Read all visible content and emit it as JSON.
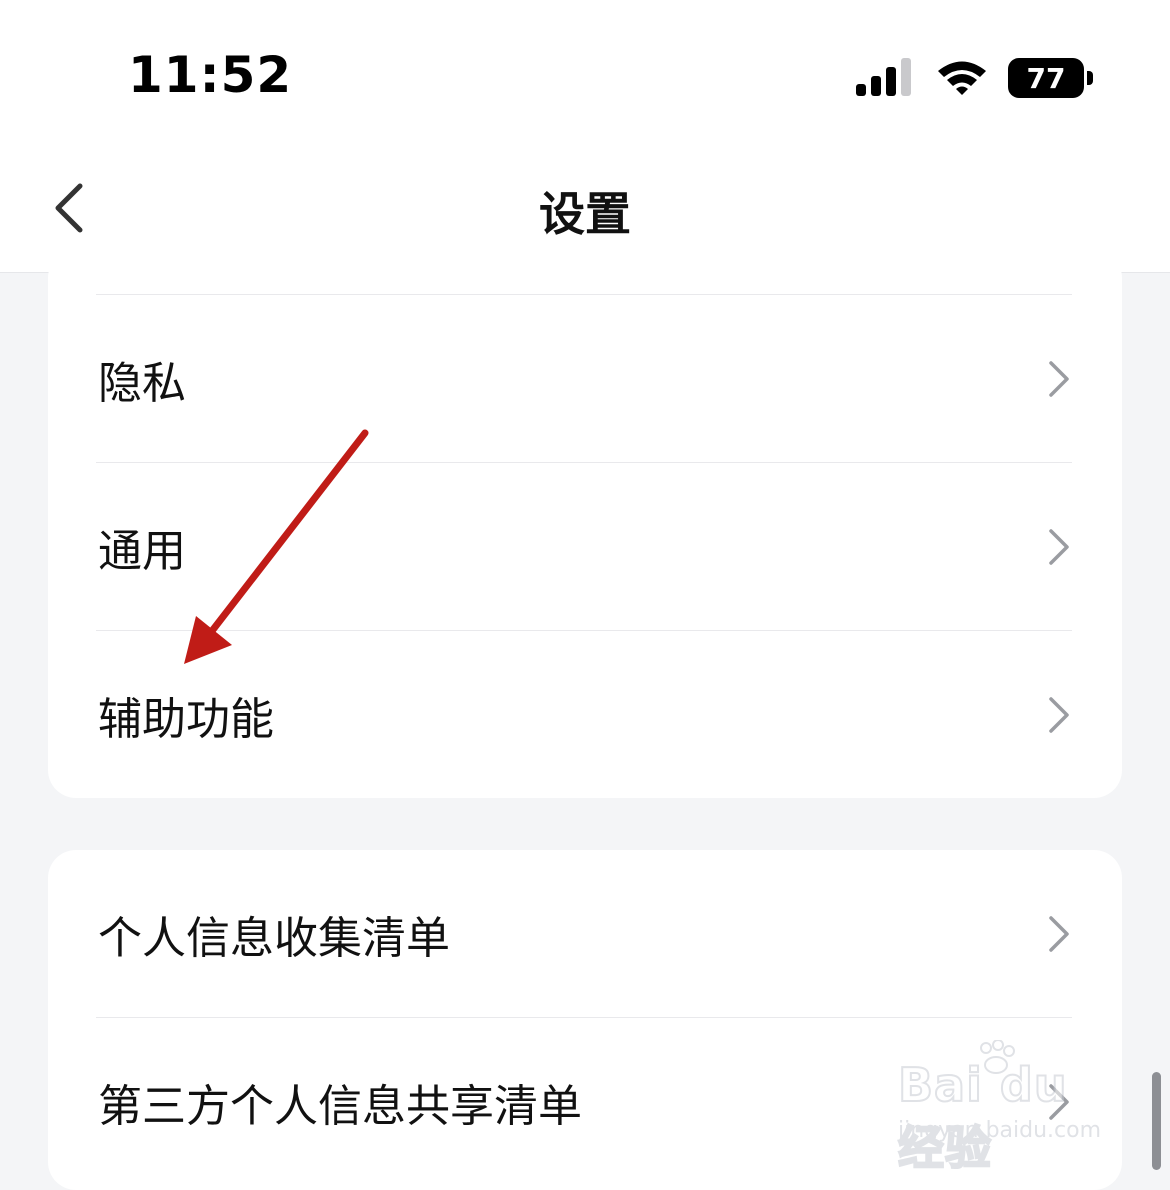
{
  "status_bar": {
    "time": "11:52",
    "battery_level": "77"
  },
  "nav": {
    "title": "设置",
    "back_icon": "chevron-left-icon"
  },
  "group1": {
    "items": [
      {
        "label": "隐私"
      },
      {
        "label": "通用"
      },
      {
        "label": "辅助功能"
      }
    ]
  },
  "group2": {
    "items": [
      {
        "label": "个人信息收集清单"
      },
      {
        "label": "第三方个人信息共享清单"
      }
    ]
  },
  "annotation": {
    "color": "#c01c17",
    "points_to": "辅助功能"
  },
  "watermark": {
    "logo": "Bai du 经验",
    "url": "jingyan.baidu.com"
  },
  "colors": {
    "background": "#f4f5f7",
    "card": "#ffffff",
    "text": "#111111",
    "chevron": "#9a9ca1"
  }
}
